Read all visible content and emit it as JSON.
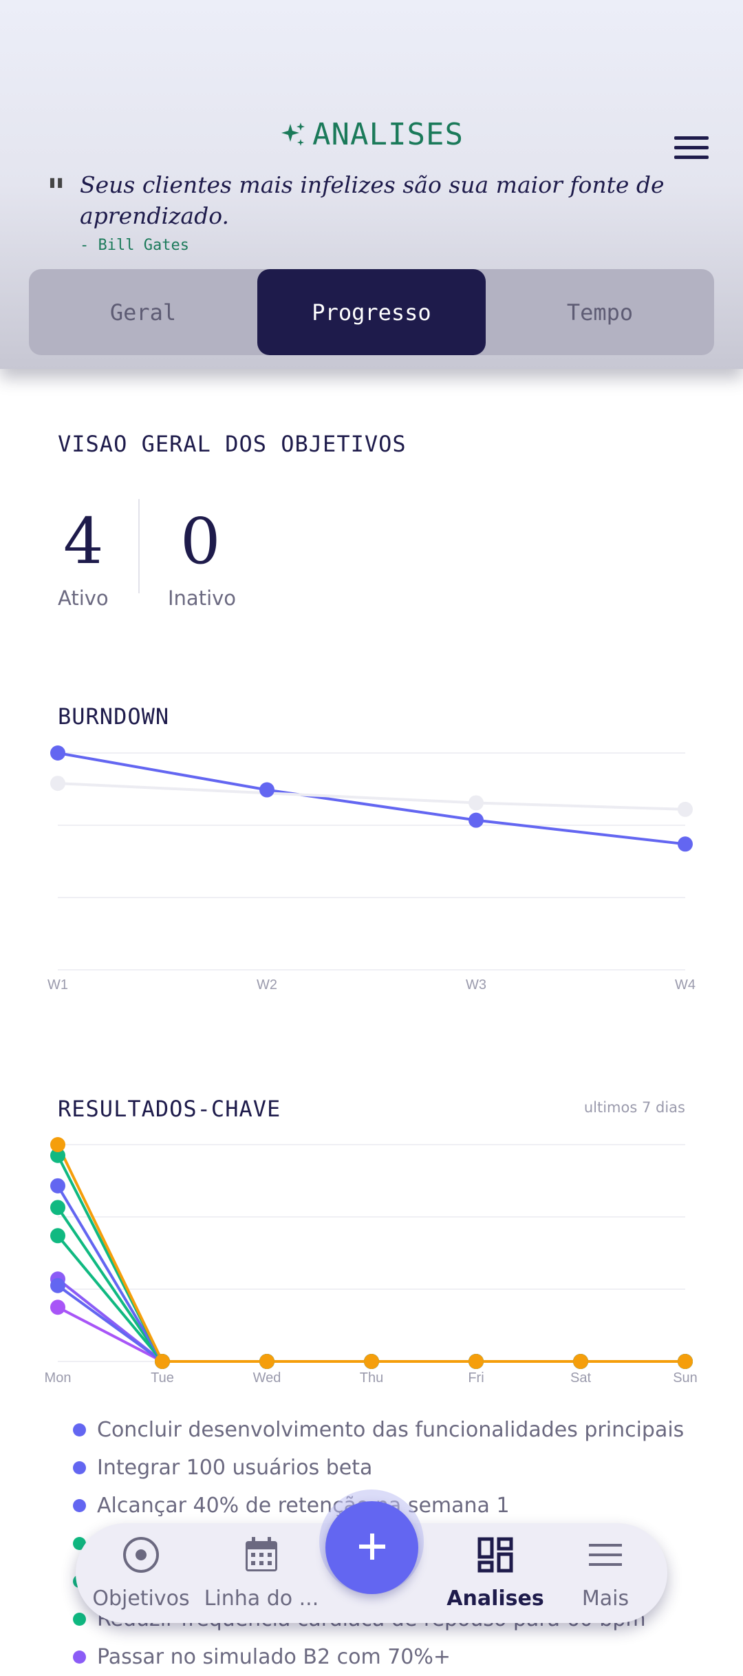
{
  "header": {
    "title": "ANALISES",
    "quote": "Seus clientes mais infelizes são sua maior fonte de aprendizado.",
    "author": "- Bill Gates",
    "tabs": [
      "Geral",
      "Progresso",
      "Tempo"
    ],
    "active_tab": "Progresso"
  },
  "overview": {
    "label": "VISAO GERAL DOS OBJETIVOS",
    "active_count": "4",
    "active_label": "Ativo",
    "inactive_count": "0",
    "inactive_label": "Inativo"
  },
  "burndown": {
    "label": "BURNDOWN"
  },
  "key_results": {
    "label": "RESULTADOS-CHAVE",
    "range": "ultimos 7 dias"
  },
  "chart_data": [
    {
      "type": "line",
      "title": "BURNDOWN",
      "x": [
        "W1",
        "W2",
        "W3",
        "W4"
      ],
      "ylim": [
        0,
        100
      ],
      "grid": true,
      "series": [
        {
          "color": "#6366f1",
          "values": [
            100,
            83,
            69,
            58
          ]
        },
        {
          "color": "#ececf2",
          "values": [
            86,
            null,
            77,
            74
          ]
        }
      ]
    },
    {
      "type": "line",
      "title": "RESULTADOS-CHAVE",
      "x": [
        "Mon",
        "Tue",
        "Wed",
        "Thu",
        "Fri",
        "Sat",
        "Sun"
      ],
      "ylim": [
        0,
        100
      ],
      "grid": true,
      "series": [
        {
          "color": "#a855f7",
          "values": [
            25,
            0,
            0,
            0,
            0,
            0,
            0
          ]
        },
        {
          "color": "#8b5cf6",
          "values": [
            38,
            0,
            0,
            0,
            0,
            0,
            0
          ]
        },
        {
          "color": "#6366f1",
          "values": [
            35,
            0,
            0,
            0,
            0,
            0,
            0
          ]
        },
        {
          "color": "#10b981",
          "values": [
            58,
            0,
            0,
            0,
            0,
            0,
            0
          ]
        },
        {
          "color": "#10b981",
          "values": [
            71,
            0,
            0,
            0,
            0,
            0,
            0
          ]
        },
        {
          "color": "#6366f1",
          "values": [
            81,
            0,
            0,
            0,
            0,
            0,
            0
          ]
        },
        {
          "color": "#10b981",
          "values": [
            95,
            0,
            0,
            0,
            0,
            0,
            0
          ]
        },
        {
          "color": "#f59e0b",
          "values": [
            100,
            0,
            0,
            0,
            0,
            0,
            0
          ]
        }
      ]
    }
  ],
  "legend": [
    {
      "label": "Concluir desenvolvimento das funcionalidades principais",
      "color": "#6366f1"
    },
    {
      "label": "Integrar 100 usuários beta",
      "color": "#6366f1"
    },
    {
      "label": "Alcançar 40% de retenção na semana 1",
      "color": "#6366f1"
    },
    {
      "label": "",
      "color": "#10b981"
    },
    {
      "label": "",
      "color": "#10b981"
    },
    {
      "label": "Reduzir frequência cardíaca de repouso para 60 bpm",
      "color": "#10b981"
    },
    {
      "label": "Passar no simulado B2 com 70%+",
      "color": "#8b5cf6"
    }
  ],
  "nav": {
    "items": [
      {
        "label": "Objetivos",
        "icon": "target-icon"
      },
      {
        "label": "Linha do ...",
        "icon": "calendar-icon"
      },
      {
        "label": "Analises",
        "icon": "dashboard-icon"
      },
      {
        "label": "Mais",
        "icon": "menu-icon"
      }
    ],
    "active": "Analises",
    "fab_icon": "plus-icon"
  }
}
